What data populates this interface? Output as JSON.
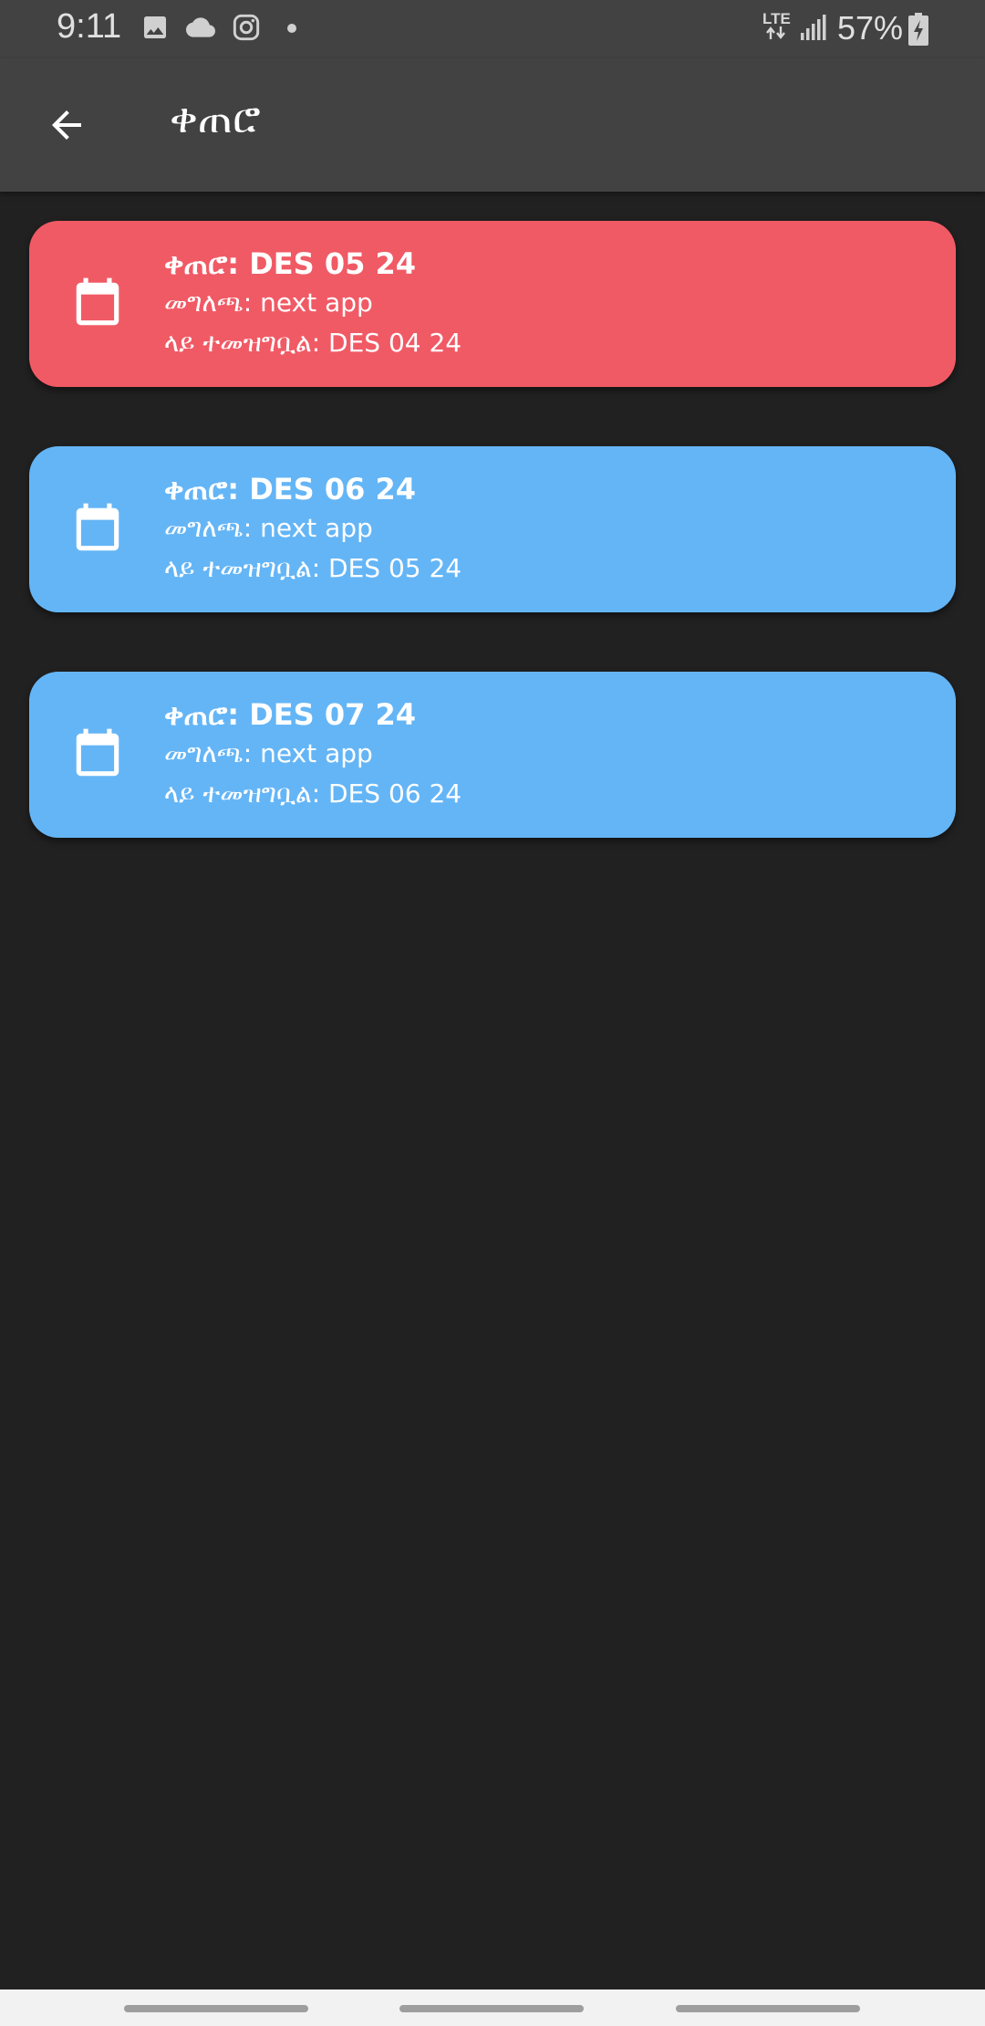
{
  "status_bar": {
    "time": "9:11",
    "network": "LTE",
    "battery": "57%",
    "icons": [
      "image-icon",
      "cloud-icon",
      "instagram-icon",
      "notification-dot-icon",
      "signal-icon",
      "battery-charging-icon"
    ]
  },
  "app_bar": {
    "title": "ቀጠሮ",
    "back_icon": "arrow-left-icon"
  },
  "entries": [
    {
      "title": "ቀጠሮ: DES 05 24",
      "description": "መግለጫ: next app",
      "registered": "ላይ ተመዝግቧል: DES 04 24",
      "color": "#f05a65",
      "icon": "calendar-icon"
    },
    {
      "title": "ቀጠሮ: DES 06 24",
      "description": "መግለጫ: next app",
      "registered": "ላይ ተመዝግቧል: DES 05 24",
      "color": "#64b5f6",
      "icon": "calendar-icon"
    },
    {
      "title": "ቀጠሮ: DES 07 24",
      "description": "መግለጫ: next app",
      "registered": "ላይ ተመዝግቧል: DES 06 24",
      "color": "#64b5f6",
      "icon": "calendar-icon"
    }
  ],
  "colors": {
    "background": "#212121",
    "app_bar": "#424242",
    "overdue_card": "#f05a65",
    "upcoming_card": "#64b5f6"
  }
}
